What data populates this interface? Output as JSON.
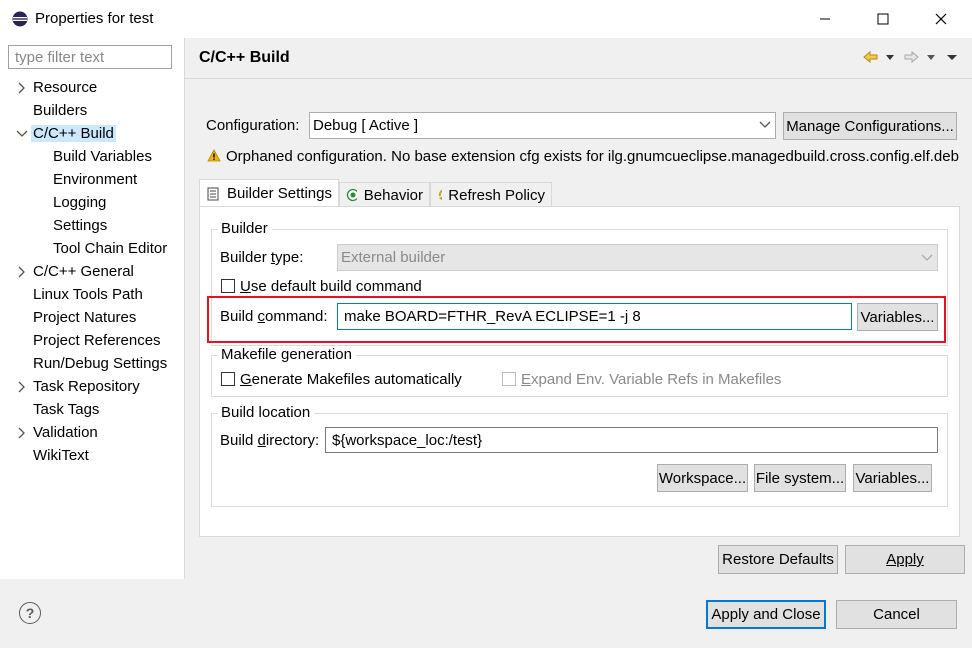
{
  "window": {
    "title": "Properties for test",
    "minimize_icon": "minimize-icon",
    "maximize_icon": "maximize-icon",
    "close_icon": "close-icon"
  },
  "sidebar": {
    "filter_placeholder": "type filter text",
    "items": [
      {
        "label": "Resource",
        "expandable": true,
        "expanded": false,
        "level": 0
      },
      {
        "label": "Builders",
        "expandable": false,
        "level": 0
      },
      {
        "label": "C/C++ Build",
        "expandable": true,
        "expanded": true,
        "level": 0,
        "selected": true
      },
      {
        "label": "Build Variables",
        "level": 1
      },
      {
        "label": "Environment",
        "level": 1
      },
      {
        "label": "Logging",
        "level": 1
      },
      {
        "label": "Settings",
        "level": 1
      },
      {
        "label": "Tool Chain Editor",
        "level": 1
      },
      {
        "label": "C/C++ General",
        "expandable": true,
        "expanded": false,
        "level": 0
      },
      {
        "label": "Linux Tools Path",
        "level": 0
      },
      {
        "label": "Project Natures",
        "level": 0
      },
      {
        "label": "Project References",
        "level": 0
      },
      {
        "label": "Run/Debug Settings",
        "level": 0
      },
      {
        "label": "Task Repository",
        "expandable": true,
        "expanded": false,
        "level": 0
      },
      {
        "label": "Task Tags",
        "level": 0
      },
      {
        "label": "Validation",
        "expandable": true,
        "expanded": false,
        "level": 0
      },
      {
        "label": "WikiText",
        "level": 0
      }
    ]
  },
  "header": {
    "title": "C/C++ Build"
  },
  "configuration": {
    "label": "Configuration:",
    "value": "Debug  [ Active ]",
    "manage_button": "Manage Configurations...",
    "warning": "Orphaned configuration. No base extension cfg exists for ilg.gnumcueclipse.managedbuild.cross.config.elf.deb"
  },
  "tabs": [
    {
      "label": "Builder Settings",
      "active": true
    },
    {
      "label": "Behavior",
      "active": false
    },
    {
      "label": "Refresh Policy",
      "active": false
    }
  ],
  "builder": {
    "group_title": "Builder",
    "type_label_pre": "Builder ",
    "type_label_u": "t",
    "type_label_post": "ype:",
    "type_value": "External builder",
    "use_default_u": "U",
    "use_default_rest": "se default build command",
    "use_default_checked": false,
    "command_label_pre": "Build ",
    "command_label_u": "c",
    "command_label_post": "ommand:",
    "command_value": "make BOARD=FTHR_RevA ECLIPSE=1 -j 8",
    "variables_button": "Variables..."
  },
  "makefile": {
    "group_title": "Makefile generation",
    "generate_u": "G",
    "generate_rest": "enerate Makefiles automatically",
    "generate_checked": false,
    "expand_u": "E",
    "expand_rest": "xpand Env. Variable Refs in Makefiles",
    "expand_checked": false
  },
  "location": {
    "group_title": "Build location",
    "dir_label_pre": "Build ",
    "dir_label_u": "d",
    "dir_label_post": "irectory:",
    "dir_value": "${workspace_loc:/test}",
    "workspace_button": "Workspace...",
    "filesystem_button": "File system...",
    "variables_button": "Variables..."
  },
  "actions": {
    "restore_defaults": "Restore Defaults",
    "apply": "Apply",
    "apply_and_close": "Apply and Close",
    "cancel": "Cancel"
  },
  "colors": {
    "highlight_border": "#e81123",
    "selection": "#cce8ff",
    "default_button_border": "#0078d7"
  }
}
